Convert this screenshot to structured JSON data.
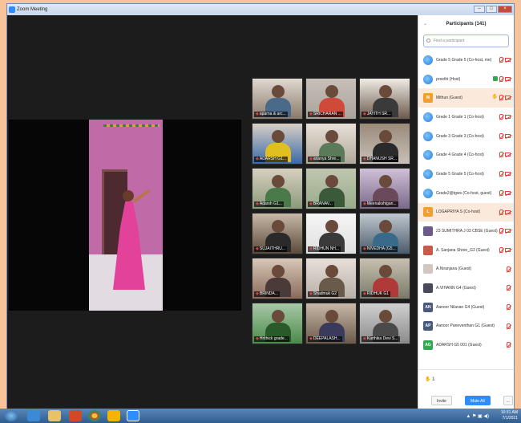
{
  "window": {
    "title": "Zoom Meeting"
  },
  "gallery": [
    {
      "label": "aparna & arc..."
    },
    {
      "label": "SRICHARAN ..."
    },
    {
      "label": "JAYITH SR..."
    },
    {
      "label": "ADARSH G1..."
    },
    {
      "label": "ananya Shre..."
    },
    {
      "label": "DHANUSH SR..."
    },
    {
      "label": "Adarsh G1..."
    },
    {
      "label": "BRANAV..."
    },
    {
      "label": "Meenakshigan..."
    },
    {
      "label": "SUJAITHRU..."
    },
    {
      "label": "RIDHUN NH..."
    },
    {
      "label": "NIVEDHA (G5..."
    },
    {
      "label": "BRINDA..."
    },
    {
      "label": "Shadmuk G2"
    },
    {
      "label": "RIDHUK G1"
    },
    {
      "label": "Hrithick grade..."
    },
    {
      "label": "DEEPALASH..."
    },
    {
      "label": "Karthika Devi S..."
    }
  ],
  "participants_panel": {
    "title": "Participants (141)",
    "search_placeholder": "Find a participant",
    "participants": [
      {
        "name": "Grade 5 Grade 5 (Co-host, me)",
        "avatar": "globe",
        "color": "#2e7bd6"
      },
      {
        "name": "preethi (Host)",
        "avatar": "globe",
        "color": "#2e7bd6"
      },
      {
        "name": "Mithun (Guest)",
        "avatar": "M",
        "color": "#f0a030"
      },
      {
        "name": "Grade 1 Grade 1 (Co-host)",
        "avatar": "globe",
        "color": "#2e7bd6"
      },
      {
        "name": "Grade 3 Grade 3 (Co-host)",
        "avatar": "globe",
        "color": "#2e7bd6"
      },
      {
        "name": "Grade 4 Grade 4 (Co-host)",
        "avatar": "globe",
        "color": "#2e7bd6"
      },
      {
        "name": "Grade 5 Grade 5 (Co-host)",
        "avatar": "globe",
        "color": "#2e7bd6"
      },
      {
        "name": "Grade2@tgws (Co-host, guest)",
        "avatar": "globe",
        "color": "#2e7bd6"
      },
      {
        "name": "LOGAPRIYA S (Co-host)",
        "avatar": "L",
        "color": "#f0a030"
      },
      {
        "name": "23 SUMITHRA J 03 CBSE (Guest)",
        "avatar": "photo",
        "color": "#6a5b8a"
      },
      {
        "name": "A. Sanjana Shree_G3 (Guest)",
        "avatar": "photo",
        "color": "#c85a4a"
      },
      {
        "name": "A.Niranjana (Guest)",
        "avatar": "photo",
        "color": "#d0c8c0"
      },
      {
        "name": "A.VIHANN G4 (Guest)",
        "avatar": "photo",
        "color": "#4a4a5a"
      },
      {
        "name": "Aanoor Nilavan G4 (Guest)",
        "avatar": "AN",
        "color": "#4a5a7a"
      },
      {
        "name": "Aanoor Paneventhan G1 (Guest)",
        "avatar": "AP",
        "color": "#4a5a7a"
      },
      {
        "name": "ADARSH G5 001 (Guest)",
        "avatar": "AG",
        "color": "#34a853"
      }
    ],
    "raised_hands": "1",
    "invite_label": "Invite",
    "mute_all_label": "Mute All",
    "more_label": "..."
  },
  "taskbar": {
    "time": "10:31 AM",
    "date": "7/1/2021"
  }
}
